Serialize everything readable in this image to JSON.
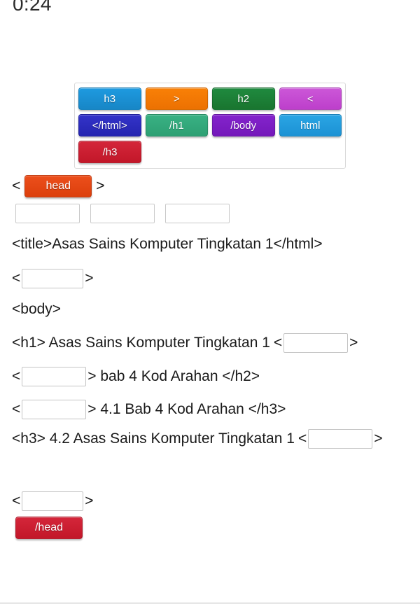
{
  "timer": {
    "value": "0:24"
  },
  "word_bank": {
    "rows": [
      [
        {
          "label": "h3",
          "color": "#1e9ae0",
          "color2": "#1786c6"
        },
        {
          "label": ">",
          "color": "#f98006",
          "color2": "#ec7102"
        },
        {
          "label": "h2",
          "color": "#1f8a3f",
          "color2": "#19752f"
        },
        {
          "label": "<",
          "color": "#cc57d8",
          "color2": "#bd3fcb"
        }
      ],
      [
        {
          "label": "</html>",
          "color": "#3434c9",
          "color2": "#2424b0"
        },
        {
          "label": "/h1",
          "color": "#39b184",
          "color2": "#2da073"
        },
        {
          "label": "/body",
          "color": "#8424cc",
          "color2": "#7418ba"
        },
        {
          "label": "html",
          "color": "#2aa5e4",
          "color2": "#1c92d4"
        }
      ],
      [
        {
          "label": "/h3",
          "color": "#d4263a",
          "color2": "#c21729"
        }
      ]
    ]
  },
  "exercise": {
    "line_head": {
      "open_angle": "<",
      "tile": {
        "label": "head",
        "color": "#ec4f1c",
        "color2": "#dc3f0c"
      },
      "close_angle": ">"
    },
    "dropzones_count": 3,
    "line_title": "<title>Asas Sains Komputer Tingkatan 1</html>",
    "line_blank_1": {
      "open_angle": "<",
      "close_angle": ">"
    },
    "line_body": "<body>",
    "line_h1": {
      "prefix": "<h1> Asas Sains Komputer Tingkatan 1",
      "open_angle": "<",
      "close_angle": ">"
    },
    "line_h2": {
      "open_angle": "<",
      "middle": "> bab 4 Kod Arahan </h2>"
    },
    "line_h3_1": {
      "open_angle": "<",
      "middle": "> 4.1 Bab 4 Kod Arahan </h3>"
    },
    "line_h3_2": {
      "prefix": "<h3> 4.2 Asas Sains Komputer Tingkatan 1",
      "open_angle": "<",
      "close_angle": ">"
    },
    "line_blank_2": {
      "open_angle": "<",
      "close_angle": ">"
    },
    "tile_head_close": {
      "label": "/head",
      "color": "#d4263a",
      "color2": "#c21729"
    }
  }
}
